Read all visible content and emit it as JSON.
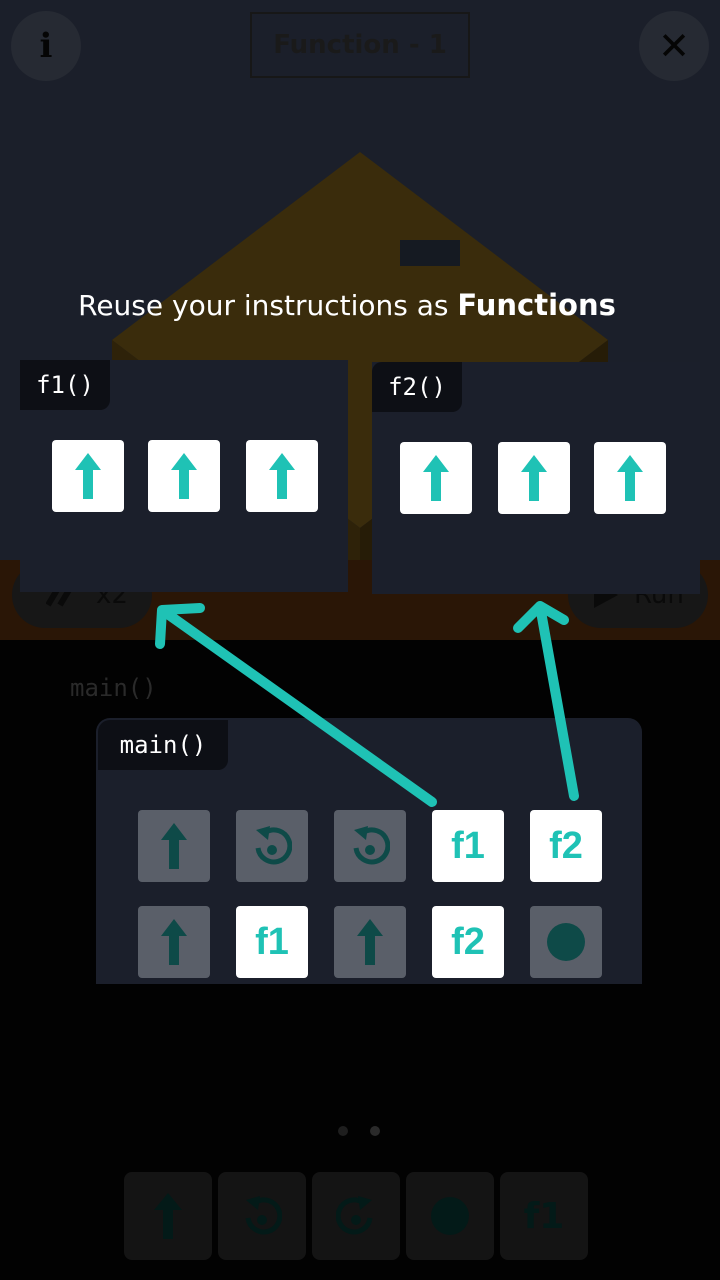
{
  "header": {
    "level_title": "Function - 1",
    "info_glyph": "i",
    "close_glyph": "✕"
  },
  "background": {
    "speed_label": "x2",
    "run_label": "Run",
    "main_label": "main()",
    "page_dots": 2,
    "active_dot": 0,
    "palette": [
      {
        "icon": "forward-arrow-icon"
      },
      {
        "icon": "turn-left-icon"
      },
      {
        "icon": "turn-right-icon"
      },
      {
        "icon": "action-dot-icon"
      },
      {
        "label": "f1"
      }
    ]
  },
  "tutorial": {
    "headline_prefix": "Reuse your instructions as ",
    "headline_bold": "Functions",
    "f1": {
      "tag": "f1()",
      "tiles": [
        "forward-arrow-icon",
        "forward-arrow-icon",
        "forward-arrow-icon"
      ]
    },
    "f2": {
      "tag": "f2()",
      "tiles": [
        "forward-arrow-icon",
        "forward-arrow-icon",
        "forward-arrow-icon"
      ]
    },
    "main": {
      "tag": "main()",
      "row1": [
        {
          "icon": "forward-arrow-icon",
          "highlight": false
        },
        {
          "icon": "turn-left-icon",
          "highlight": false
        },
        {
          "icon": "turn-left-icon",
          "highlight": false
        },
        {
          "label": "f1",
          "highlight": true
        },
        {
          "label": "f2",
          "highlight": true
        }
      ],
      "row2": [
        {
          "icon": "forward-arrow-icon",
          "highlight": false
        },
        {
          "label": "f1",
          "highlight": true
        },
        {
          "icon": "forward-arrow-icon",
          "highlight": false
        },
        {
          "label": "f2",
          "highlight": true
        },
        {
          "icon": "action-dot-icon",
          "highlight": false
        }
      ]
    }
  },
  "colors": {
    "accent": "#1fc2b5",
    "dim_icon": "#0e4a48",
    "panel": "#1b1f2b",
    "tag": "#0d0f15"
  }
}
